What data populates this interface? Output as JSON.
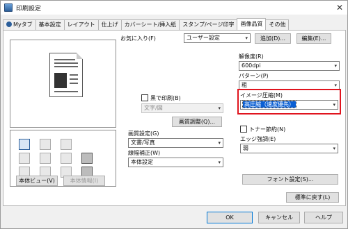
{
  "window": {
    "title": "印刷設定",
    "close_label": "✕"
  },
  "tabs": [
    {
      "label": "Myタブ"
    },
    {
      "label": "基本設定"
    },
    {
      "label": "レイアウト"
    },
    {
      "label": "仕上げ"
    },
    {
      "label": "カバーシート/挿入紙"
    },
    {
      "label": "スタンプ/ページ印字"
    },
    {
      "label": "画像品質"
    },
    {
      "label": "その他"
    }
  ],
  "favorites": {
    "label": "お気に入り(F)",
    "value": "ユーザー設定",
    "add": "追加(D)...",
    "edit": "編集(E)..."
  },
  "left_buttons": {
    "main_view": "本体ビュー(V)",
    "main_info": "本体情報(I)"
  },
  "bw": {
    "label": "黒で印刷(B)",
    "select": "文字/図"
  },
  "image_adjust": "画質調整(Q)...",
  "quality": {
    "label": "画質設定(G)",
    "value": "文書/写真"
  },
  "line_width": {
    "label": "線幅補正(W)",
    "value": "本体設定"
  },
  "resolution": {
    "label": "解像度(R)",
    "value": "600dpi"
  },
  "pattern": {
    "label": "パターン(P)",
    "value": "粗"
  },
  "image_compression": {
    "label": "イメージ圧縮(M)",
    "value": "高圧縮（速度優先）"
  },
  "toner_save": {
    "label": "トナー節約(N)"
  },
  "edge_enhance": {
    "label": "エッジ強調(E)",
    "value": "弱"
  },
  "font_settings": "フォント設定(S)...",
  "restore_default": "標準に戻す(L)",
  "footer": {
    "ok": "OK",
    "cancel": "キャンセル",
    "help": "ヘルプ"
  },
  "colors": {
    "highlight_box": "#e0141e",
    "selection": "#0a5fd4"
  },
  "checkboxes": {
    "bw_print": false,
    "toner_save": false
  }
}
